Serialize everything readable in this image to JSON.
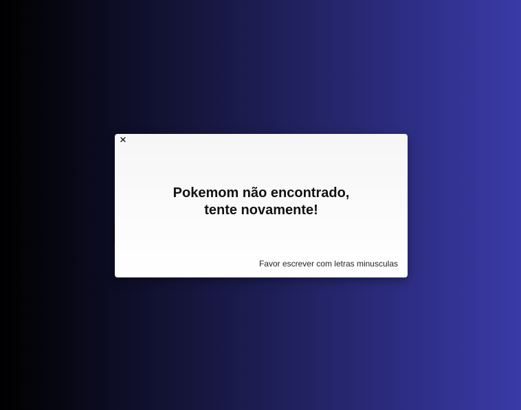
{
  "modal": {
    "close_label": "✕",
    "message_line1": "Pokemom não encontrado,",
    "message_line2": "tente novamente!",
    "hint": "Favor escrever com letras minusculas"
  },
  "colors": {
    "background_start": "#000000",
    "background_end": "#3a3aa8",
    "modal_bg": "#ffffff"
  },
  "icons": {
    "close": "close-icon"
  }
}
